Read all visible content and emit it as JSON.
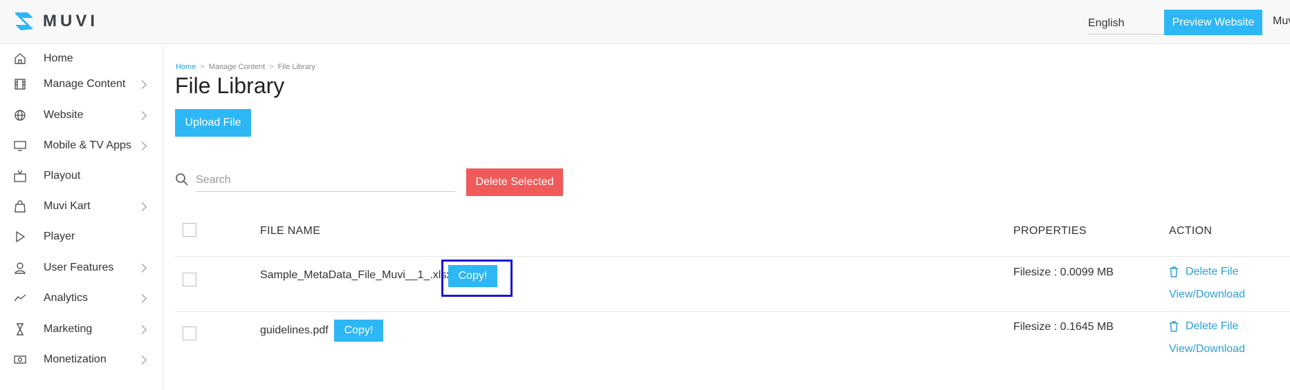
{
  "header": {
    "brand": "MUVI",
    "language": "English",
    "preview_label": "Preview Website",
    "user_label": "Muv"
  },
  "sidebar": {
    "items": [
      {
        "label": "Home",
        "icon": "home-icon",
        "has_children": false
      },
      {
        "label": "Manage Content",
        "icon": "film-icon",
        "has_children": true
      },
      {
        "label": "Website",
        "icon": "globe-icon",
        "has_children": true
      },
      {
        "label": "Mobile & TV Apps",
        "icon": "monitor-icon",
        "has_children": true
      },
      {
        "label": "Playout",
        "icon": "tv-antenna-icon",
        "has_children": false
      },
      {
        "label": "Muvi Kart",
        "icon": "shopping-bag-icon",
        "has_children": true
      },
      {
        "label": "Player",
        "icon": "play-icon",
        "has_children": false
      },
      {
        "label": "User Features",
        "icon": "user-icon",
        "has_children": true
      },
      {
        "label": "Analytics",
        "icon": "trend-line-icon",
        "has_children": true
      },
      {
        "label": "Marketing",
        "icon": "hourglass-icon",
        "has_children": true
      },
      {
        "label": "Monetization",
        "icon": "banknote-icon",
        "has_children": true
      }
    ]
  },
  "breadcrumb": {
    "items": [
      "Home",
      "Manage Content",
      "File Library"
    ],
    "separator": ">"
  },
  "main": {
    "title": "File Library",
    "upload_label": "Upload File",
    "search_placeholder": "Search",
    "delete_selected_label": "Delete Selected"
  },
  "table": {
    "headers": {
      "file_name": "FILE NAME",
      "properties": "PROPERTIES",
      "action": "ACTION"
    },
    "rows": [
      {
        "file_name": "Sample_MetaData_File_Muvi__1_.xlsx",
        "copy_label": "Copy!",
        "filesize": "Filesize : 0.0099 MB",
        "delete_label": "Delete File",
        "view_label": "View/Download"
      },
      {
        "file_name": "guidelines.pdf",
        "copy_label": "Copy!",
        "filesize": "Filesize : 0.1645 MB",
        "delete_label": "Delete File",
        "view_label": "View/Download"
      }
    ]
  },
  "colors": {
    "accent": "#2db7f5",
    "danger": "#f15a5a",
    "link": "#2d9fd9",
    "highlight": "#1a16d6"
  }
}
